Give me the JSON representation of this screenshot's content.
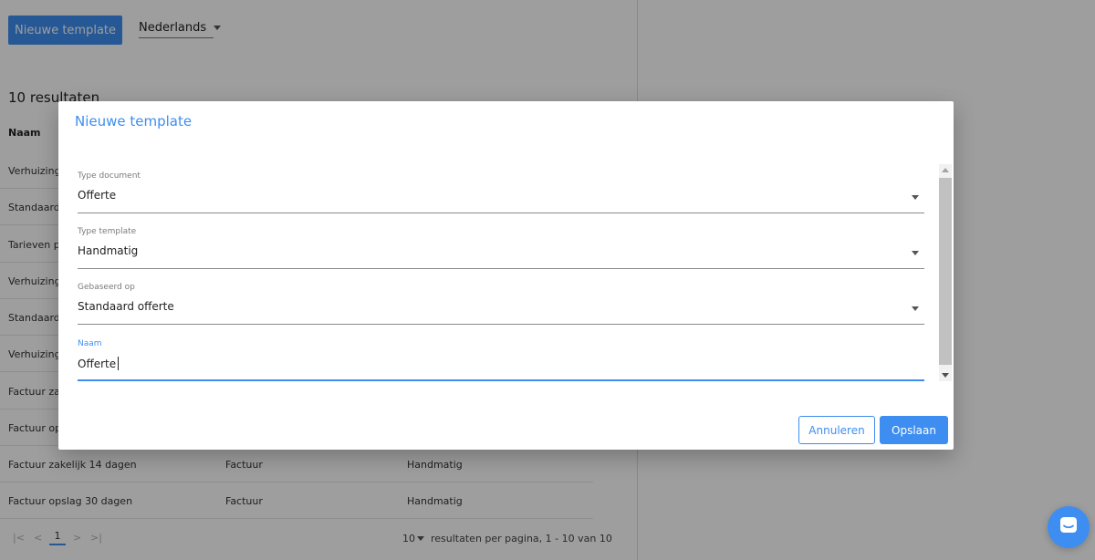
{
  "background": {
    "new_template_button": "Nieuwe template",
    "language": "Nederlands",
    "result_count": "10 resultaten",
    "column_name": "Naam",
    "rows": [
      {
        "name": "Verhuizing",
        "type": "",
        "template": ""
      },
      {
        "name": "Standaard",
        "type": "",
        "template": ""
      },
      {
        "name": "Tarieven pa",
        "type": "",
        "template": ""
      },
      {
        "name": "Verhuizing",
        "type": "",
        "template": ""
      },
      {
        "name": "Standaard",
        "type": "",
        "template": ""
      },
      {
        "name": "Verhuizing",
        "type": "",
        "template": ""
      },
      {
        "name": "Factuur zak",
        "type": "",
        "template": ""
      },
      {
        "name": "Factuur op",
        "type": "",
        "template": ""
      },
      {
        "name": "Factuur zakelijk 14 dagen",
        "type": "Factuur",
        "template": "Handmatig"
      },
      {
        "name": "Factuur opslag 30 dagen",
        "type": "Factuur",
        "template": "Handmatig"
      }
    ],
    "pager": {
      "first": "|<",
      "prev": "<",
      "current_page": "1",
      "next": ">",
      "last": ">|",
      "per_page": "10",
      "summary": "resultaten per pagina, 1 - 10 van 10"
    }
  },
  "dialog": {
    "title": "Nieuwe template",
    "fields": [
      {
        "label": "Type document",
        "value": "Offerte"
      },
      {
        "label": "Type template",
        "value": "Handmatig"
      },
      {
        "label": "Gebaseerd op",
        "value": "Standaard offerte"
      },
      {
        "label": "Naam",
        "value": "Offerte"
      }
    ],
    "cancel_label": "Annuleren",
    "save_label": "Opslaan"
  },
  "colors": {
    "accent": "#3d8ef0",
    "overlay": "rgba(0,0,0,0.38)"
  },
  "icons": {
    "chat": "chat-bubble-icon",
    "dropdown": "caret-down-icon"
  }
}
